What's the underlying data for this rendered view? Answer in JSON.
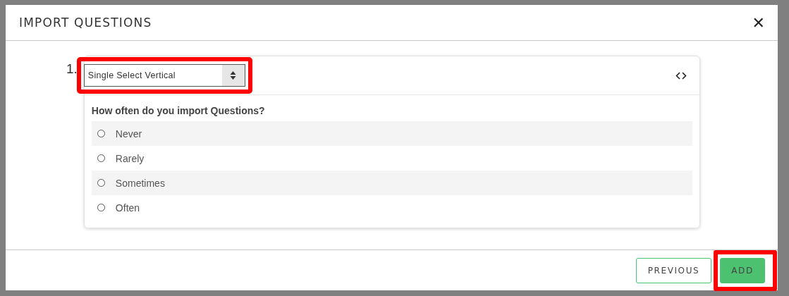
{
  "dialog": {
    "title": "IMPORT QUESTIONS",
    "close": "✕"
  },
  "question": {
    "number": "1.",
    "type_select": {
      "value": "Single Select Vertical",
      "highlighted": true
    },
    "text": "How often do you import Questions?",
    "options": [
      {
        "label": "Never",
        "selected": false
      },
      {
        "label": "Rarely",
        "selected": false
      },
      {
        "label": "Sometimes",
        "selected": false
      },
      {
        "label": "Often",
        "selected": false
      }
    ]
  },
  "buttons": [
    {
      "label": "PREVIOUS",
      "kind": "outline",
      "highlighted": false
    },
    {
      "label": "ADD",
      "kind": "primary",
      "highlighted": true
    }
  ]
}
